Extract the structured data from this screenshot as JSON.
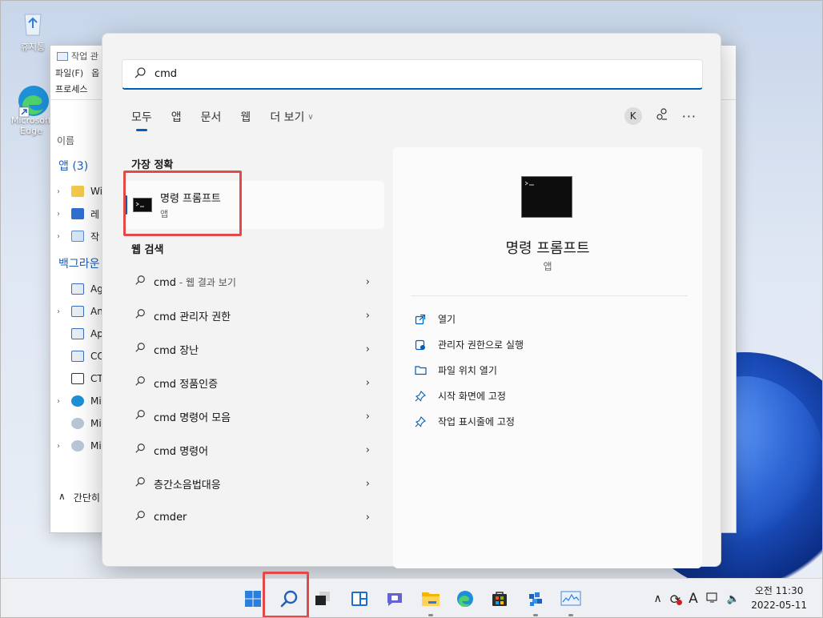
{
  "desktop": {
    "recycle_bin_label": "휴지통",
    "edge_label_line1": "Microsoft",
    "edge_label_line2": "Edge"
  },
  "task_manager": {
    "title": "작업 관",
    "menu_file": "파일(F)",
    "menu_partial": "옵",
    "tab_processes": "프로세스",
    "col_name": "이름",
    "apps_count": "(3)",
    "apps_prefix": "앱",
    "background_title": "백그라운",
    "rows": [
      {
        "label": "Wi",
        "chevron": "›"
      },
      {
        "label": "레",
        "chevron": "›"
      },
      {
        "label": "작",
        "chevron": "›"
      }
    ],
    "bg_rows": [
      {
        "label": "Ag",
        "chevron": ""
      },
      {
        "label": "An",
        "chevron": "›"
      },
      {
        "label": "Ap",
        "chevron": ""
      },
      {
        "label": "CO",
        "chevron": ""
      },
      {
        "label": "CT",
        "chevron": ""
      },
      {
        "label": "Mi",
        "chevron": "›"
      },
      {
        "label": "Mi",
        "chevron": ""
      },
      {
        "label": "Mi",
        "chevron": "›"
      }
    ],
    "footer_label": "간단히"
  },
  "search": {
    "query": "cmd",
    "icon": "search-icon"
  },
  "filter_tabs": [
    {
      "label": "모두",
      "active": true
    },
    {
      "label": "앱",
      "active": false
    },
    {
      "label": "문서",
      "active": false
    },
    {
      "label": "웹",
      "active": false
    },
    {
      "label": "더 보기",
      "active": false
    }
  ],
  "account_initial": "K",
  "best_match": {
    "section_title": "가장 정확",
    "name": "명령 프롬프트",
    "type": "앱"
  },
  "web_search": {
    "section_title": "웹 검색",
    "items": [
      {
        "main": "cmd",
        "sub": " - 웹 결과 보기"
      },
      {
        "main": "cmd 관리자 권한",
        "sub": ""
      },
      {
        "main": "cmd 장난",
        "sub": ""
      },
      {
        "main": "cmd 정품인증",
        "sub": ""
      },
      {
        "main": "cmd 명령어 모음",
        "sub": ""
      },
      {
        "main": "cmd 명령어",
        "sub": ""
      },
      {
        "main": "층간소음법대응",
        "sub": ""
      },
      {
        "main": "cmder",
        "sub": ""
      }
    ]
  },
  "detail": {
    "name": "명령 프롬프트",
    "type": "앱",
    "actions": [
      {
        "label": "열기",
        "icon": "open-icon"
      },
      {
        "label": "관리자 권한으로 실행",
        "icon": "admin-shield-icon"
      },
      {
        "label": "파일 위치 열기",
        "icon": "folder-icon"
      },
      {
        "label": "시작 화면에 고정",
        "icon": "pin-icon"
      },
      {
        "label": "작업 표시줄에 고정",
        "icon": "pin-icon"
      }
    ]
  },
  "taskbar": {
    "clock_time": "오전 11:30",
    "clock_date": "2022-05-11",
    "ime": "A",
    "accent": "#005fb8",
    "highlight": "#e24a4a"
  }
}
